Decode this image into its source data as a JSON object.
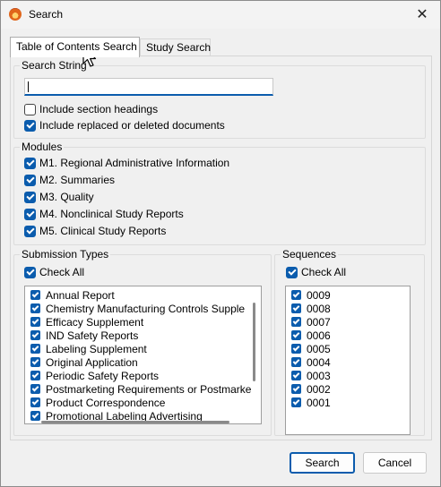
{
  "window": {
    "title": "Search",
    "close_glyph": "✕"
  },
  "tabs": [
    {
      "label": "Table of Contents Search",
      "active": true
    },
    {
      "label": "Study Search",
      "active": false
    }
  ],
  "search_string": {
    "legend": "Search String",
    "value": "",
    "include_section_headings": {
      "label": "Include section headings",
      "checked": false
    },
    "include_replaced": {
      "label": "Include replaced or deleted documents",
      "checked": true
    }
  },
  "modules": {
    "legend": "Modules",
    "items": [
      {
        "label": "M1. Regional Administrative Information",
        "checked": true
      },
      {
        "label": "M2. Summaries",
        "checked": true
      },
      {
        "label": "M3. Quality",
        "checked": true
      },
      {
        "label": "M4. Nonclinical Study Reports",
        "checked": true
      },
      {
        "label": "M5. Clinical Study Reports",
        "checked": true
      }
    ]
  },
  "submission_types": {
    "legend": "Submission Types",
    "check_all": {
      "label": "Check All",
      "checked": true
    },
    "items": [
      {
        "label": "Annual Report",
        "checked": true
      },
      {
        "label": "Chemistry Manufacturing Controls Supple",
        "checked": true
      },
      {
        "label": "Efficacy Supplement",
        "checked": true
      },
      {
        "label": "IND Safety Reports",
        "checked": true
      },
      {
        "label": "Labeling Supplement",
        "checked": true
      },
      {
        "label": "Original Application",
        "checked": true
      },
      {
        "label": "Periodic Safety Reports",
        "checked": true
      },
      {
        "label": "Postmarketing Requirements or Postmarke",
        "checked": true
      },
      {
        "label": "Product Correspondence",
        "checked": true
      },
      {
        "label": "Promotional Labeling Advertising",
        "checked": true
      }
    ]
  },
  "sequences": {
    "legend": "Sequences",
    "check_all": {
      "label": "Check All",
      "checked": true
    },
    "items": [
      {
        "label": "0009",
        "checked": true
      },
      {
        "label": "0008",
        "checked": true
      },
      {
        "label": "0007",
        "checked": true
      },
      {
        "label": "0006",
        "checked": true
      },
      {
        "label": "0005",
        "checked": true
      },
      {
        "label": "0004",
        "checked": true
      },
      {
        "label": "0003",
        "checked": true
      },
      {
        "label": "0002",
        "checked": true
      },
      {
        "label": "0001",
        "checked": true
      }
    ]
  },
  "buttons": {
    "search": "Search",
    "cancel": "Cancel"
  },
  "colors": {
    "accent": "#0b5cad",
    "dialog_bg": "#f0f0f0"
  }
}
